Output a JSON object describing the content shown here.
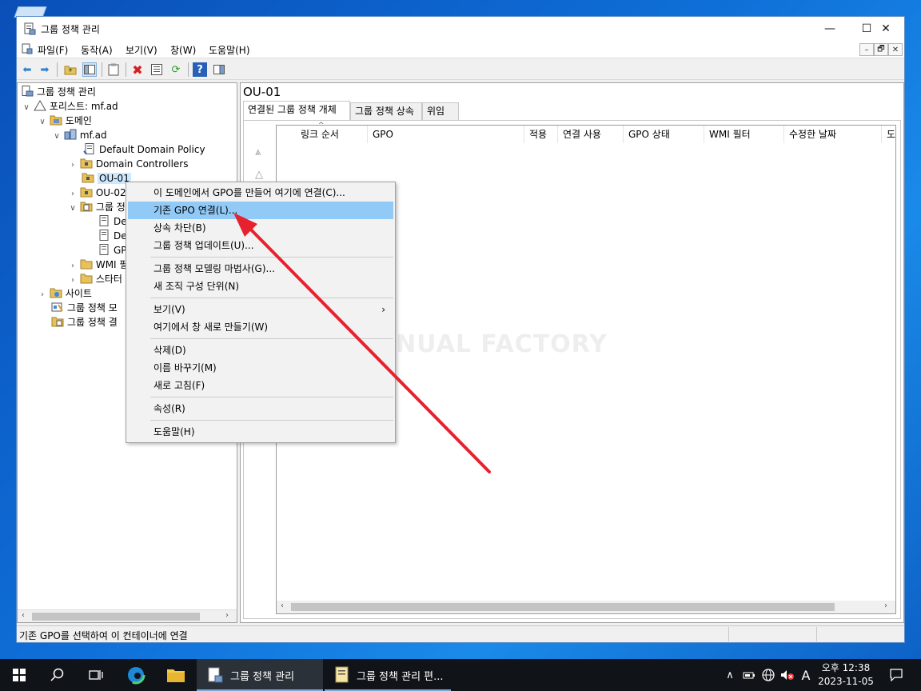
{
  "window": {
    "title": "그룹 정책 관리",
    "controls": {
      "minimize": "—",
      "maximize": "☐",
      "close": "✕"
    }
  },
  "menubar": {
    "items": [
      "파일(F)",
      "동작(A)",
      "보기(V)",
      "창(W)",
      "도움말(H)"
    ],
    "mdi": {
      "min": "–",
      "restore": "🗗",
      "close": "✕"
    }
  },
  "tree": {
    "root": "그룹 정책 관리",
    "forest": "포리스트: mf.ad",
    "domains": "도메인",
    "domain": "mf.ad",
    "default_policy": "Default Domain Policy",
    "domain_controllers": "Domain Controllers",
    "ou01": "OU-01",
    "ou02": "OU-02",
    "gpo_folder": "그룹 정",
    "gpo_child1": "De",
    "gpo_child2": "De",
    "gpo_child3": "GP",
    "wmi": "WMI 필",
    "starter": "스타터",
    "sites": "사이트",
    "modeling": "그룹 정책 모",
    "results": "그룹 정책 결"
  },
  "right": {
    "title": "OU-01",
    "tabs": [
      "연결된 그룹 정책 개체",
      "그룹 정책 상속",
      "위임"
    ],
    "columns": [
      "링크 순서",
      "GPO",
      "적용",
      "연결 사용",
      "GPO 상태",
      "WMI 필터",
      "수정한 날짜",
      "도"
    ]
  },
  "context_menu": {
    "items": [
      "이 도메인에서 GPO를 만들어 여기에 연결(C)...",
      "기존 GPO 연결(L)...",
      "상속 차단(B)",
      "그룹 정책 업데이트(U)...",
      "그룹 정책 모델링 마법사(G)...",
      "새 조직 구성 단위(N)",
      "보기(V)",
      "여기에서 창 새로 만들기(W)",
      "삭제(D)",
      "이름 바꾸기(M)",
      "새로 고침(F)",
      "속성(R)",
      "도움말(H)"
    ],
    "highlighted_index": 1
  },
  "watermark": "MANUAL FACTORY",
  "status": {
    "text": "기존 GPO를 선택하여 이 컨테이너에 연결"
  },
  "taskbar": {
    "task1": "그룹 정책 관리",
    "task2": "그룹 정책 관리 편...",
    "ime": "A",
    "time": "오후 12:38",
    "date": "2023-11-05"
  },
  "colors": {
    "highlight": "#91c9f7",
    "selection": "#cce8ff",
    "arrow": "#e8212e",
    "taskbar": "#101418"
  }
}
